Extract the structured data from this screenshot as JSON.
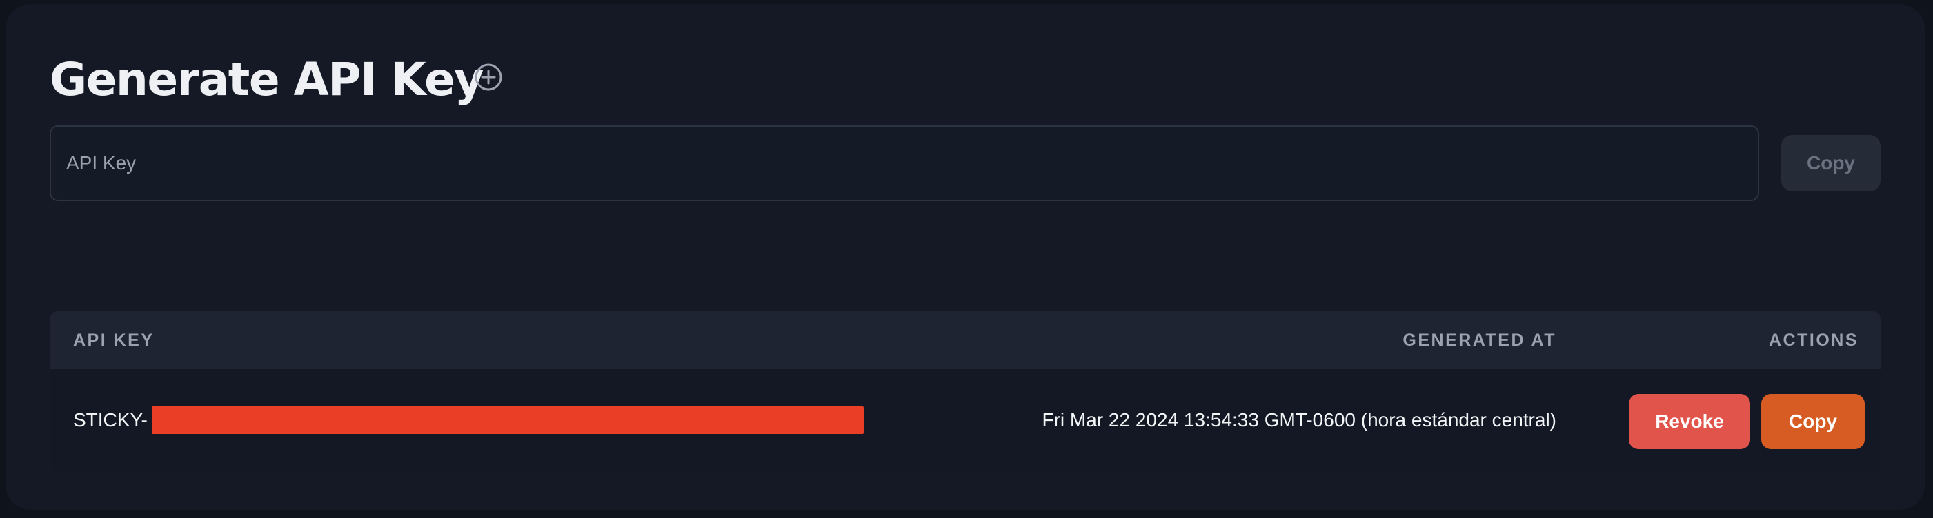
{
  "header": {
    "title": "Generate API Key",
    "add_icon": "plus-circle-icon"
  },
  "key_field": {
    "placeholder": "API Key",
    "value": "",
    "copy_label": "Copy"
  },
  "table": {
    "columns": [
      "API KEY",
      "GENERATED AT",
      "ACTIONS"
    ],
    "rows": [
      {
        "api_key_prefix": "STICKY-",
        "api_key_redacted": true,
        "generated_at": "Fri Mar 22 2024 13:54:33 GMT-0600 (hora estándar central)",
        "actions": [
          "Revoke",
          "Copy"
        ]
      }
    ]
  },
  "colors": {
    "background": "#141925",
    "revoke": "#e1544b",
    "copy": "#d65c23",
    "redaction": "#ea3e26"
  }
}
